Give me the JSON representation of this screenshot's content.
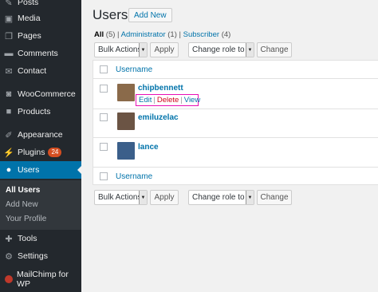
{
  "sidebar": {
    "items": [
      {
        "label": "Posts",
        "icon": "pushpin-icon"
      },
      {
        "label": "Media",
        "icon": "media-icon"
      },
      {
        "label": "Pages",
        "icon": "pages-icon"
      },
      {
        "label": "Comments",
        "icon": "comment-icon"
      },
      {
        "label": "Contact",
        "icon": "envelope-icon"
      },
      {
        "label": "WooCommerce",
        "icon": "woocommerce-icon"
      },
      {
        "label": "Products",
        "icon": "box-icon"
      },
      {
        "label": "Appearance",
        "icon": "paintbrush-icon"
      },
      {
        "label": "Plugins",
        "icon": "plug-icon",
        "badge": "24"
      },
      {
        "label": "Users",
        "icon": "user-icon",
        "active": true
      },
      {
        "label": "Tools",
        "icon": "wrench-icon"
      },
      {
        "label": "Settings",
        "icon": "settings-icon"
      },
      {
        "label": "MailChimp for WP",
        "icon": "mailchimp-icon"
      }
    ],
    "submenu": [
      "All Users",
      "Add New",
      "Your Profile"
    ]
  },
  "header": {
    "title": "Users",
    "add_new": "Add New"
  },
  "filters": {
    "all": "All",
    "all_count": "(5)",
    "administrator": "Administrator",
    "administrator_count": "(1)",
    "subscriber": "Subscriber",
    "subscriber_count": "(4)",
    "separator": "|"
  },
  "bulk_top": {
    "bulk_select": "Bulk Actions",
    "apply": "Apply",
    "role_select": "Change role to…",
    "change": "Change"
  },
  "bulk_bottom": {
    "bulk_select": "Bulk Actions",
    "apply": "Apply",
    "role_select": "Change role to…",
    "change": "Change"
  },
  "table": {
    "column_header": "Username",
    "rows": [
      {
        "username": "chipbennett",
        "avatar_color": "#8a6a4a"
      },
      {
        "username": "emiluzelac",
        "avatar_color": "#6b5444"
      },
      {
        "username": "lance",
        "avatar_color": "#3b5f8a"
      }
    ],
    "row_actions": {
      "edit": "Edit",
      "delete": "Delete",
      "view": "View",
      "sep": "|"
    }
  },
  "colors": {
    "sidebar_bg": "#23282d",
    "active": "#0073aa",
    "link": "#0073aa",
    "delete": "#d0021b",
    "highlight": "#e80fb6",
    "badge": "#d54e21"
  }
}
